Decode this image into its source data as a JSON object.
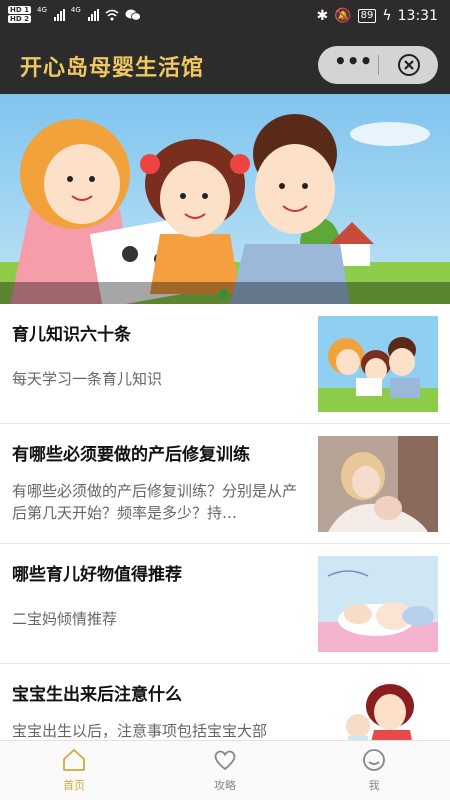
{
  "status_bar": {
    "hd1": "HD 1",
    "hd2": "HD 2",
    "net1": "4G",
    "net2": "4G",
    "battery": "89",
    "time": "13:31"
  },
  "header": {
    "title": "开心岛母婴生活馆",
    "more_label": "•••",
    "close_icon": "close-circle-icon"
  },
  "banner": {
    "slide_count": 1,
    "active_index": 0
  },
  "articles": [
    {
      "title": "育儿知识六十条",
      "desc": "每天学习一条育儿知识"
    },
    {
      "title": "有哪些必须要做的产后修复训练",
      "desc": "有哪些必须做的产后修复训练？分别是从产后第几天开始？频率是多少？持…"
    },
    {
      "title": "哪些育儿好物值得推荐",
      "desc": "二宝妈倾情推荐"
    },
    {
      "title": "宝宝生出来后注意什么",
      "desc": "宝宝出生以后，注意事项包括宝宝大部"
    }
  ],
  "tabbar": {
    "home": "首页",
    "guide": "攻略",
    "me": "我",
    "active_color": "#d7a73a",
    "inactive_color": "#888888"
  }
}
